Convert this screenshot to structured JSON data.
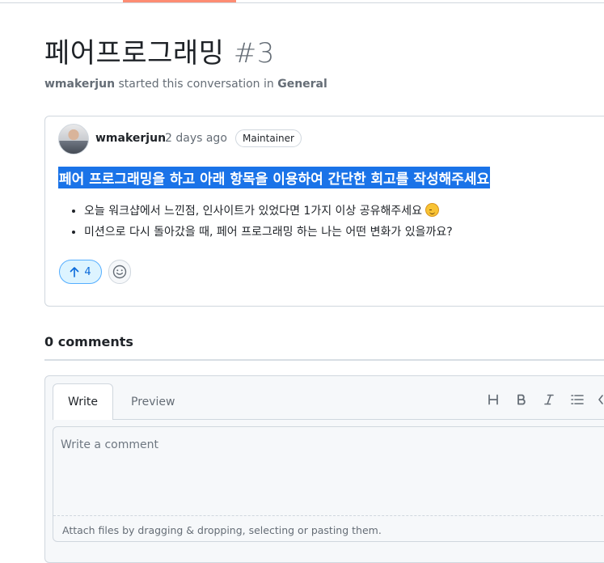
{
  "discussion": {
    "title": "페어프로그래밍",
    "number": "#3",
    "author": "wmakerjun",
    "started_text": "started this conversation in",
    "category": "General"
  },
  "post": {
    "author": "wmakerjun",
    "time_ago": "2 days ago",
    "badge": "Maintainer",
    "heading": "페어 프로그래밍을 하고 아래 항목을 이용하여 간단한 회고를 작성해주세요",
    "bullets": [
      "오늘 워크샵에서 느낀점, 인사이트가 있었다면 1가지 이상 공유해주세요",
      "미션으로 다시 돌아갔을 때, 페어 프로그래밍 하는 나는 어떤 변화가 있을까요?"
    ],
    "upvotes": "4"
  },
  "comments": {
    "count_label": "0 comments"
  },
  "editor": {
    "tab_write": "Write",
    "tab_preview": "Preview",
    "toolbar": [
      "heading-icon",
      "bold-icon",
      "italic-icon",
      "list-icon",
      "code-icon"
    ],
    "placeholder": "Write a comment",
    "attach_text": "Attach files by dragging & dropping, selecting or pasting them."
  },
  "colors": {
    "accent": "#fd8c73",
    "selection": "#1a73e8",
    "upvote_bg": "#ddf4ff",
    "upvote_fg": "#0969da"
  }
}
